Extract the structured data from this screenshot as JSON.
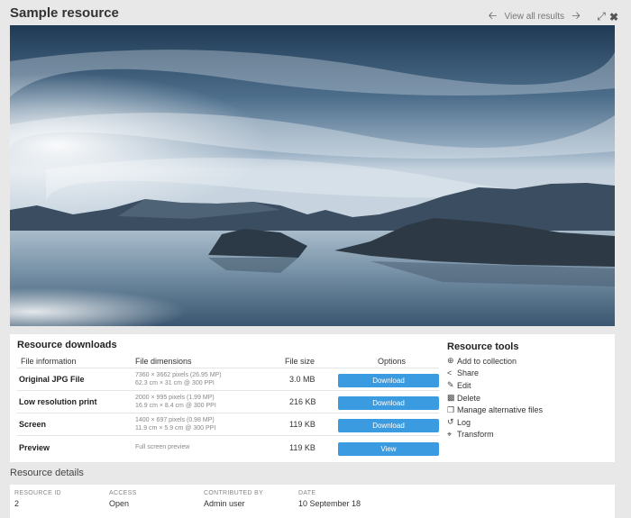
{
  "header": {
    "title": "Sample resource",
    "view_all": "View all results"
  },
  "icons": {
    "prev": "arrow-left-icon",
    "next": "arrow-right-icon",
    "expand": "expand-icon",
    "close": "close-icon"
  },
  "downloads": {
    "title": "Resource downloads",
    "columns": [
      "File information",
      "File dimensions",
      "File size",
      "Options"
    ],
    "rows": [
      {
        "name": "Original JPG File",
        "dim1": "7360 × 3662 pixels (26.95 MP)",
        "dim2": "62.3 cm × 31 cm @ 300 PPI",
        "size": "3.0 MB",
        "action": "Download"
      },
      {
        "name": "Low resolution print",
        "dim1": "2000 × 995 pixels (1.99 MP)",
        "dim2": "16.9 cm × 8.4 cm @ 300 PPI",
        "size": "216 KB",
        "action": "Download"
      },
      {
        "name": "Screen",
        "dim1": "1400 × 697 pixels (0.98 MP)",
        "dim2": "11.9 cm × 5.9 cm @ 300 PPI",
        "size": "119 KB",
        "action": "Download"
      },
      {
        "name": "Preview",
        "dim1": "Full screen preview",
        "dim2": "",
        "size": "119 KB",
        "action": "View"
      }
    ]
  },
  "tools": {
    "title": "Resource tools",
    "items": [
      {
        "icon": "plus-circle-icon",
        "label": "Add to collection"
      },
      {
        "icon": "share-icon",
        "label": "Share"
      },
      {
        "icon": "pencil-icon",
        "label": "Edit"
      },
      {
        "icon": "trash-icon",
        "label": "Delete"
      },
      {
        "icon": "files-icon",
        "label": "Manage alternative files"
      },
      {
        "icon": "history-icon",
        "label": "Log"
      },
      {
        "icon": "crop-icon",
        "label": "Transform"
      }
    ]
  },
  "details": {
    "title": "Resource details",
    "fields": [
      {
        "label": "RESOURCE ID",
        "value": "2"
      },
      {
        "label": "ACCESS",
        "value": "Open"
      },
      {
        "label": "CONTRIBUTED BY",
        "value": "Admin user"
      },
      {
        "label": "DATE",
        "value": "10 September 18"
      }
    ]
  },
  "colors": {
    "accent": "#3a9be0",
    "background": "#e8e8e8",
    "card": "#ffffff"
  }
}
